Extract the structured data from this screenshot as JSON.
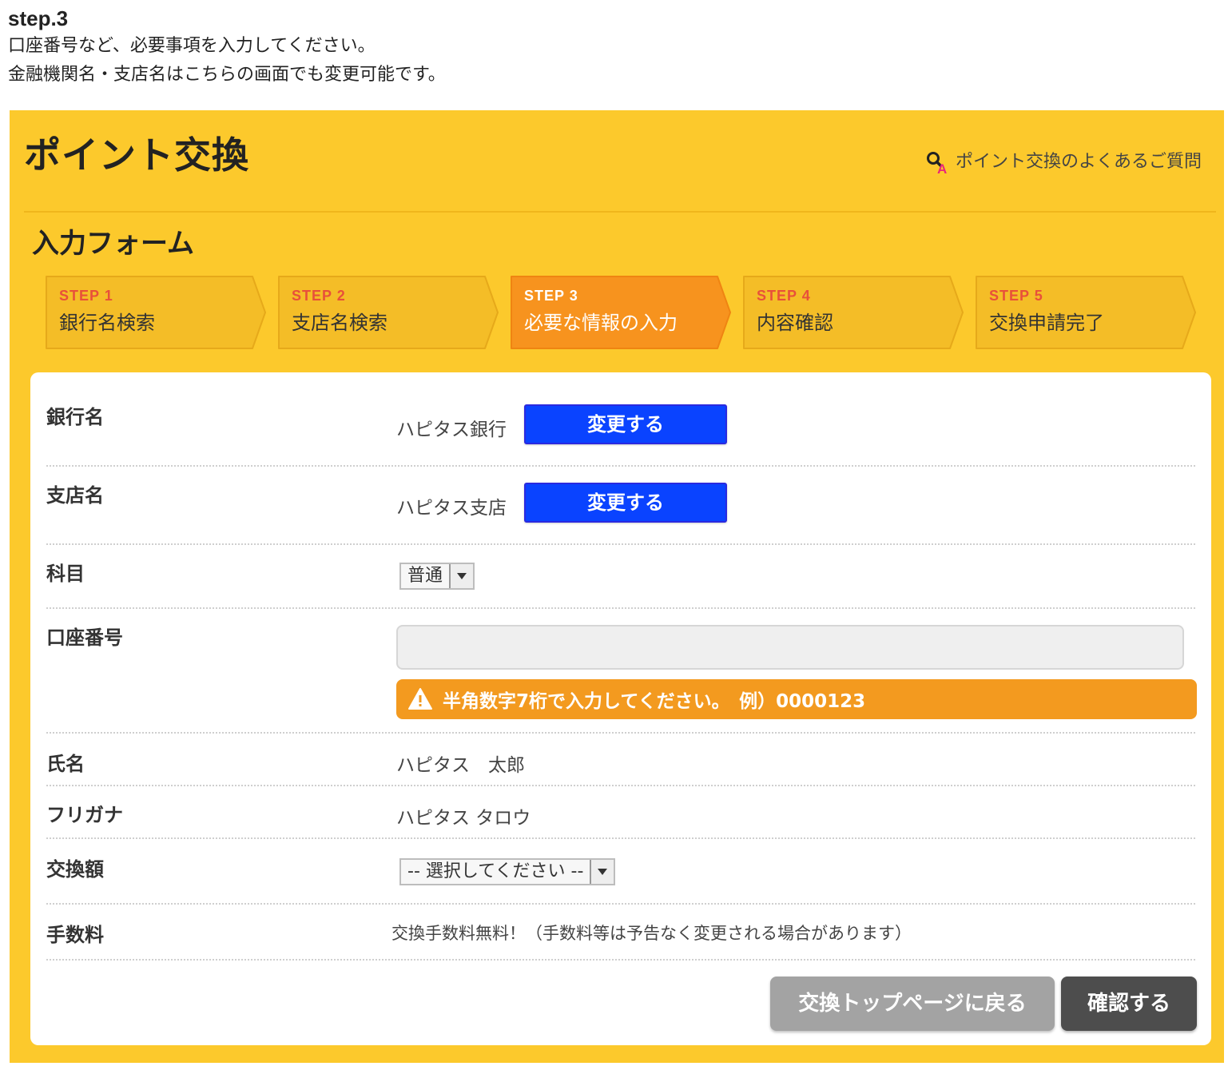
{
  "intro": {
    "step_title": "step.3",
    "line1": "口座番号など、必要事項を入力してください。",
    "line2": "金融機関名・支店名はこちらの画面でも変更可能です。"
  },
  "header": {
    "title": "ポイント交換",
    "faq_link": "ポイント交換のよくあるご質問",
    "faq_icon": "search-a-icon"
  },
  "form_title": "入力フォーム",
  "steps": [
    {
      "num": "STEP 1",
      "label": "銀行名検索",
      "active": false
    },
    {
      "num": "STEP 2",
      "label": "支店名検索",
      "active": false
    },
    {
      "num": "STEP 3",
      "label": "必要な情報の入力",
      "active": true
    },
    {
      "num": "STEP 4",
      "label": "内容確認",
      "active": false
    },
    {
      "num": "STEP 5",
      "label": "交換申請完了",
      "active": false
    }
  ],
  "form": {
    "bank": {
      "label": "銀行名",
      "value": "ハピタス銀行",
      "button": "変更する"
    },
    "branch": {
      "label": "支店名",
      "value": "ハピタス支店",
      "button": "変更する"
    },
    "account_type": {
      "label": "科目",
      "selected": "普通"
    },
    "account_number": {
      "label": "口座番号",
      "value": "",
      "placeholder": "",
      "warning": "半角数字7桁で入力してください。　例）0000123"
    },
    "name": {
      "label": "氏名",
      "value": "ハピタス　太郎"
    },
    "furigana": {
      "label": "フリガナ",
      "value": "ハピタス タロウ"
    },
    "amount": {
      "label": "交換額",
      "selected": "-- 選択してください --"
    },
    "fee": {
      "label": "手数料",
      "value": "交換手数料無料！（手数料等は予告なく変更される場合があります）"
    }
  },
  "buttons": {
    "back": "交換トップページに戻る",
    "confirm": "確認する"
  },
  "colors": {
    "panel_bg": "#fcc92c",
    "step_active": "#f7931e",
    "step_inactive": "#f4bd27",
    "step_num": "#e8503a",
    "change_button": "#0a43ff",
    "warning_bg": "#f39a1f",
    "back_button": "#a3a3a3",
    "confirm_button": "#4d4d4d"
  }
}
